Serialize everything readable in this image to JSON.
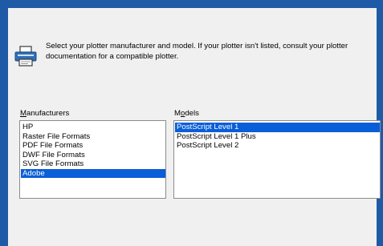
{
  "instruction": "Select your plotter manufacturer and model.  If your plotter isn't listed, consult your plotter documentation for a compatible plotter.",
  "manufacturers": {
    "label_accel": "M",
    "label_rest": "anufacturers",
    "items": [
      {
        "label": "HP",
        "selected": false
      },
      {
        "label": "Raster File Formats",
        "selected": false
      },
      {
        "label": "PDF File Formats",
        "selected": false
      },
      {
        "label": "DWF File Formats",
        "selected": false
      },
      {
        "label": "SVG File Formats",
        "selected": false
      },
      {
        "label": "Adobe",
        "selected": true
      }
    ]
  },
  "models": {
    "label_pre": "M",
    "label_accel": "o",
    "label_rest": "dels",
    "items": [
      {
        "label": "PostScript Level 1",
        "selected": true
      },
      {
        "label": "PostScript Level 1 Plus",
        "selected": false
      },
      {
        "label": "PostScript Level 2",
        "selected": false
      }
    ]
  },
  "colors": {
    "frame": "#1f5aa6",
    "selection": "#0a5ed7",
    "background": "#f0f0f0"
  }
}
